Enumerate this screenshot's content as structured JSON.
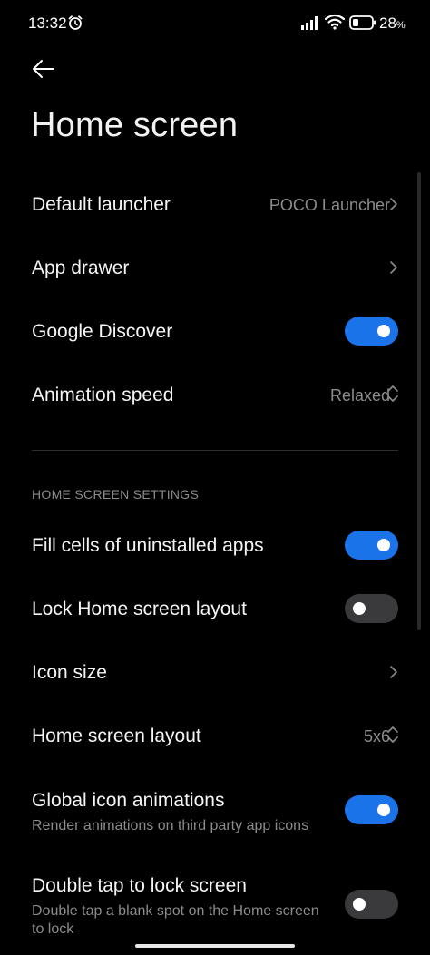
{
  "status_bar": {
    "time": "13:32",
    "battery_percent": "28",
    "battery_unit": "%",
    "icons": [
      "alarm-icon",
      "signal-icon",
      "wifi-icon",
      "battery-icon"
    ]
  },
  "header": {
    "title": "Home screen",
    "back_icon": "arrow-left-icon"
  },
  "items": {
    "default_launcher": {
      "title": "Default launcher",
      "value": "POCO Launcher"
    },
    "app_drawer": {
      "title": "App drawer"
    },
    "google_discover": {
      "title": "Google Discover",
      "enabled": true
    },
    "animation_speed": {
      "title": "Animation speed",
      "value": "Relaxed"
    }
  },
  "section": {
    "header": "HOME SCREEN SETTINGS",
    "items": {
      "fill_cells": {
        "title": "Fill cells of uninstalled apps",
        "enabled": true
      },
      "lock_layout": {
        "title": "Lock Home screen layout",
        "enabled": false
      },
      "icon_size": {
        "title": "Icon size"
      },
      "layout": {
        "title": "Home screen layout",
        "value": "5x6"
      },
      "global_icon_animations": {
        "title": "Global icon animations",
        "subtitle": "Render animations on third party app icons",
        "enabled": true
      },
      "double_tap_lock": {
        "title": "Double tap to lock screen",
        "subtitle": "Double tap a blank spot on the Home screen to lock",
        "enabled": false
      }
    }
  },
  "colors": {
    "background": "#000000",
    "accent": "#1a73e8",
    "toggle_off": "#3a3a3c",
    "secondary_text": "#8c8c8c"
  }
}
